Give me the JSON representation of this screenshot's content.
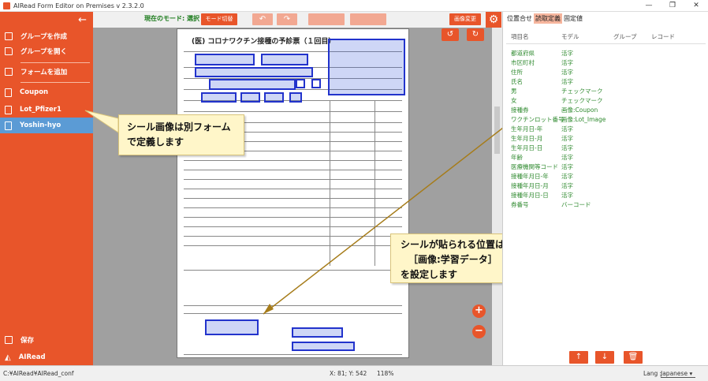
{
  "window": {
    "title": "AIRead Form Editor on Premises v 2.3.2.0",
    "controls": [
      "—",
      "❐",
      "✕"
    ]
  },
  "sidebar": {
    "back_icon": "←",
    "items": [
      {
        "label": "グループを作成",
        "icon": "plus-square-icon"
      },
      {
        "label": "グループを開く",
        "icon": "folder-open-icon"
      },
      {
        "label": "フォームを追加",
        "icon": "plus-square-icon"
      },
      {
        "label": "Coupon",
        "icon": "document-icon"
      },
      {
        "label": "Lot_Pfizer1",
        "icon": "document-icon"
      },
      {
        "label": "Yoshin-hyo",
        "icon": "document-icon",
        "selected": true
      }
    ],
    "save_label": "保存",
    "logo": "AIRead"
  },
  "toolbar": {
    "mode_label": "現在のモード: 選択",
    "mode_switch": "モード切替",
    "undo": "↶",
    "redo": "↷",
    "disabled_btn_1": "",
    "disabled_btn_2": "",
    "image_change": "画像変更",
    "settings_icon": "⚙"
  },
  "document": {
    "title": "(医) コロナワクチン接種の予診票（１回目）",
    "rotate_left": "↺",
    "rotate_right": "↻",
    "zoom_in": "+",
    "zoom_out": "−"
  },
  "callouts": {
    "left_line1": "シール画像は別フォーム",
    "left_line2": "で定義します",
    "right_line1": "シールが貼られる位置は",
    "right_line2": "［画像:学習データ］",
    "right_line3": "を設定します"
  },
  "right_panel": {
    "tabs": [
      "位置合せ",
      "読取定義",
      "固定値"
    ],
    "selected_tab": 1,
    "columns": [
      "項目名",
      "モデル",
      "グループ",
      "レコード"
    ],
    "rows": [
      {
        "name": "都道府県",
        "model": "活字"
      },
      {
        "name": "市区町村",
        "model": "活字"
      },
      {
        "name": "住所",
        "model": "活字"
      },
      {
        "name": "氏名",
        "model": "活字"
      },
      {
        "name": "男",
        "model": "チェックマーク"
      },
      {
        "name": "女",
        "model": "チェックマーク"
      },
      {
        "name": "接種券",
        "model": "画像:Coupon"
      },
      {
        "name": "ワクチンロット番号",
        "model": "画像:Lot_Image"
      },
      {
        "name": "生年月日-年",
        "model": "活字"
      },
      {
        "name": "生年月日-月",
        "model": "活字"
      },
      {
        "name": "生年月日-日",
        "model": "活字"
      },
      {
        "name": "年齢",
        "model": "活字"
      },
      {
        "name": "医療機関等コード",
        "model": "活字"
      },
      {
        "name": "接種年月日-年",
        "model": "活字"
      },
      {
        "name": "接種年月日-月",
        "model": "活字"
      },
      {
        "name": "接種年月日-日",
        "model": "活字"
      },
      {
        "name": "券番号",
        "model": "バーコード"
      }
    ],
    "up_icon": "↑",
    "down_icon": "↓",
    "delete_icon": "🗑"
  },
  "status": {
    "path": "C:¥AIRead¥AIRead_conf",
    "coords": "X: 81; Y: 542",
    "zoom": "118%",
    "lang_label": "Lang :",
    "lang_value": "Japanese"
  },
  "colors": {
    "accent": "#e8552a",
    "selected": "#5b9bd5",
    "field_box": "#2233cc",
    "model_text": "#2f8a2f"
  }
}
